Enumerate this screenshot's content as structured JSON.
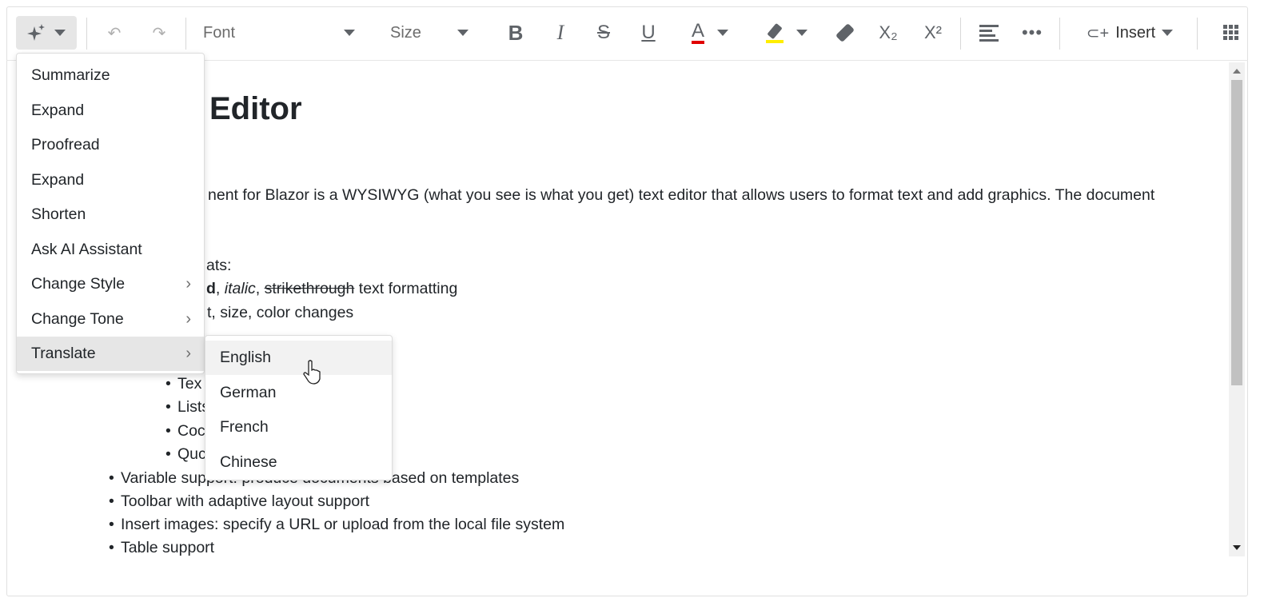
{
  "toolbar": {
    "ai_icon": "sparkle-icon",
    "undo_icon": "undo-icon",
    "redo_icon": "redo-icon",
    "font_placeholder": "Font",
    "size_placeholder": "Size",
    "bold": "B",
    "italic": "I",
    "strike": "S",
    "underline": "U",
    "font_color": "A",
    "font_color_value": "#e00000",
    "highlight_color_value": "#ffee00",
    "subscript": "X₂",
    "superscript": "X²",
    "insert_label": "Insert"
  },
  "content": {
    "title": "Editor",
    "para": "nent for Blazor is a WYSIWYG (what you see is what you get) text editor that allows users to format text and add graphics. The document",
    "formats_label": "ats:",
    "fmt_bold": "d",
    "fmt_sep1": ", ",
    "fmt_italic": "italic",
    "fmt_sep2": ", ",
    "fmt_strike": "strikethrough",
    "fmt_rest": " text formatting",
    "fmt_line2": "t, size, color changes",
    "sub_items": [
      "Tex",
      "Lists",
      "Coc",
      "Quc"
    ],
    "items": [
      "Variable support: produce documents based on templates",
      "Toolbar with adaptive layout support",
      "Insert images: specify a URL or upload from the local file system",
      "Table support"
    ]
  },
  "ai_menu": {
    "items": [
      {
        "label": "Summarize"
      },
      {
        "label": "Expand"
      },
      {
        "label": "Proofread"
      },
      {
        "label": "Expand"
      },
      {
        "label": "Shorten"
      },
      {
        "label": "Ask AI Assistant"
      },
      {
        "label": "Change Style",
        "submenu": true
      },
      {
        "label": "Change Tone",
        "submenu": true
      },
      {
        "label": "Translate",
        "submenu": true,
        "selected": true
      }
    ]
  },
  "translate_menu": {
    "items": [
      "English",
      "German",
      "French",
      "Chinese"
    ],
    "hovered": "English"
  }
}
